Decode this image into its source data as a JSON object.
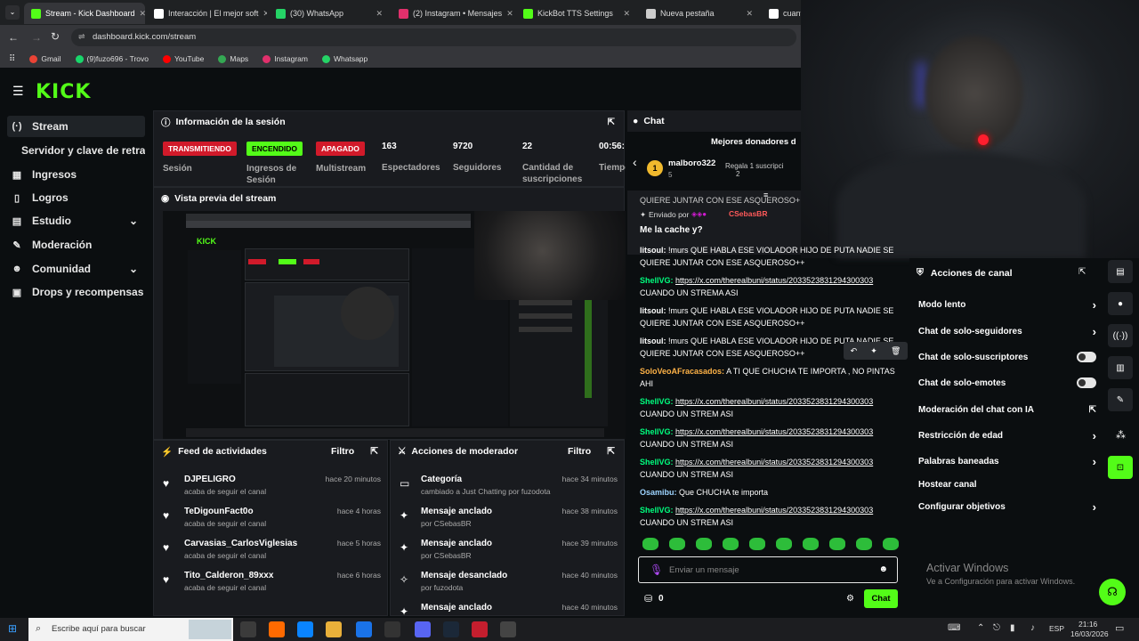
{
  "browser": {
    "tabs": [
      {
        "title": "Stream - Kick Dashboard",
        "color": "#53fc18",
        "active": true
      },
      {
        "title": "Interacción | El mejor soft",
        "color": "#ffffff"
      },
      {
        "title": "(30) WhatsApp",
        "color": "#25d366"
      },
      {
        "title": "(2) Instagram • Mensajes",
        "color": "#e1306c"
      },
      {
        "title": "KickBot TTS Settings",
        "color": "#53fc18"
      },
      {
        "title": "Nueva pestaña",
        "color": "#cccccc"
      },
      {
        "title": "cuant",
        "color": "#ffffff"
      }
    ],
    "url": "dashboard.kick.com/stream",
    "bookmarks": [
      "Gmail",
      "(9)fuzo696 - Trovo",
      "YouTube",
      "Maps",
      "Instagram",
      "Whatsapp"
    ]
  },
  "kick": {
    "logo": "KICK",
    "sidebar": [
      {
        "label": "Stream",
        "icon": "(·)",
        "selected": true
      },
      {
        "label": "Servidor y clave de retransmi",
        "icon": ""
      },
      {
        "label": "Ingresos",
        "icon": "▦"
      },
      {
        "label": "Logros",
        "icon": "▯"
      },
      {
        "label": "Estudio",
        "icon": "▤",
        "chevron": true
      },
      {
        "label": "Moderación",
        "icon": "✎"
      },
      {
        "label": "Comunidad",
        "icon": "☻",
        "chevron": true
      },
      {
        "label": "Drops y recompensas",
        "icon": "▣"
      }
    ],
    "session": {
      "title": "Información de la sesión",
      "stats": [
        {
          "badge": "TRANSMITIENDO",
          "label": "Sesión"
        },
        {
          "badge": "ENCENDIDO",
          "label": "Ingresos de Sesión"
        },
        {
          "badge": "APAGADO",
          "label": "Multistream"
        },
        {
          "value": "163",
          "label": "Espectadores"
        },
        {
          "value": "9720",
          "label": "Seguidores"
        },
        {
          "value": "22",
          "label": "Cantidad de suscripciones"
        },
        {
          "value": "00:56:",
          "label": "Tiempo en vivo"
        }
      ]
    },
    "preview": {
      "title": "Vista previa del stream"
    },
    "feed": {
      "title": "Feed de actividades",
      "filter": "Filtro",
      "items": [
        {
          "name": "DJPELIGRO",
          "sub": "acaba de seguir el canal",
          "time": "hace 20 minutos"
        },
        {
          "name": "TeDigounFact0o",
          "sub": "acaba de seguir el canal",
          "time": "hace 4 horas"
        },
        {
          "name": "Carvasias_CarlosViglesias",
          "sub": "acaba de seguir el canal",
          "time": "hace 5 horas"
        },
        {
          "name": "Tito_Calderon_89xxx",
          "sub": "acaba de seguir el canal",
          "time": "hace 6 horas"
        }
      ]
    },
    "modactions": {
      "title": "Acciones de moderador",
      "filter": "Filtro",
      "items": [
        {
          "title": "Categoría",
          "sub": "cambiado a Just Chatting por fuzodota",
          "time": "hace 34 minutos",
          "icon": "▭"
        },
        {
          "title": "Mensaje anclado",
          "sub": "por CSebasBR",
          "time": "hace 38 minutos",
          "icon": "✦"
        },
        {
          "title": "Mensaje anclado",
          "sub": "por CSebasBR",
          "time": "hace 39 minutos",
          "icon": "✦"
        },
        {
          "title": "Mensaje desanclado",
          "sub": "por fuzodota",
          "time": "hace 40 minutos",
          "icon": "✧"
        },
        {
          "title": "Mensaje anclado",
          "sub": "",
          "time": "hace 40 minutos",
          "icon": "✦"
        }
      ]
    },
    "chat": {
      "title": "Chat",
      "donors_title": "Mejores donadores d",
      "donor": {
        "name": "malboro322",
        "sub": "5",
        "text": "Regala 1 suscripci",
        "count": "2"
      },
      "pinned_partial": "QUIERE JUNTAR CON ESE ASQUEROSO++",
      "pinned_by": "Enviado por",
      "pinned_user": "CSebasBR",
      "pinned_text": "Me la cache y?",
      "messages": [
        {
          "user": "litsoul:",
          "text": "!murs QUE HABLA ESE VIOLADOR HIJO DE PUTA NADIE SE QUIERE JUNTAR CON ESE ASQUEROSO++",
          "color": "#ffffff"
        },
        {
          "user": "ShellVG:",
          "link": "https://x.com/therealbuni/status/2033523831294300303",
          "text": "CUANDO UN STREMA ASI",
          "color": "#00ff7f"
        },
        {
          "user": "litsoul:",
          "text": "!murs QUE HABLA ESE VIOLADOR HIJO DE PUTA NADIE SE QUIERE JUNTAR CON ESE ASQUEROSO++",
          "color": "#ffffff"
        },
        {
          "user": "litsoul:",
          "text": "!murs QUE HABLA ESE VIOLADOR HIJO DE PUTA NADIE SE QUIERE JUNTAR CON ESE ASQUEROSO++",
          "color": "#ffffff"
        },
        {
          "user": "SoloVeoAFracasados:",
          "text": "A TI QUE CHUCHA TE IMPORTA , NO PINTAS AHI",
          "color": "#ffb347"
        },
        {
          "user": "ShellVG:",
          "link": "https://x.com/therealbuni/status/2033523831294300303",
          "text": "CUANDO UN STREM ASI",
          "color": "#00ff7f"
        },
        {
          "user": "ShellVG:",
          "link": "https://x.com/therealbuni/status/2033523831294300303",
          "text": "CUANDO UN STREM ASI",
          "color": "#00ff7f"
        },
        {
          "user": "ShellVG:",
          "link": "https://x.com/therealbuni/status/2033523831294300303",
          "text": "CUANDO UN STREM ASI",
          "color": "#00ff7f"
        },
        {
          "user": "Osamibu:",
          "text": "Que CHUCHA te importa",
          "color": "#9dd4ff"
        },
        {
          "user": "ShellVG:",
          "link": "https://x.com/therealbuni/status/2033523831294300303",
          "text": "CUANDO UN STREM ASI",
          "color": "#00ff7f"
        }
      ],
      "input_placeholder": "Enviar un mensaje",
      "points": "0",
      "send_label": "Chat"
    },
    "channel_actions": {
      "title": "Acciones de canal",
      "items": [
        {
          "label": "Modo lento",
          "control": "chevron"
        },
        {
          "label": "Chat de solo-seguidores",
          "control": "chevron"
        },
        {
          "label": "Chat de solo-suscriptores",
          "control": "toggle"
        },
        {
          "label": "Chat de solo-emotes",
          "control": "toggle"
        },
        {
          "label": "Moderación del chat con IA",
          "control": "external"
        },
        {
          "label": "Restricción de edad",
          "control": "chevron"
        },
        {
          "label": "Palabras baneadas",
          "control": "chevron"
        },
        {
          "label": "Hostear canal",
          "control": "none"
        },
        {
          "label": "Configurar objetivos",
          "control": "chevron"
        }
      ]
    }
  },
  "windows": {
    "activate_title": "Activar Windows",
    "activate_sub": "Ve a Configuración para activar Windows.",
    "search_placeholder": "Escribe aquí para buscar",
    "lang": "ESP",
    "time": "21:16",
    "date": "16/03/2026"
  }
}
